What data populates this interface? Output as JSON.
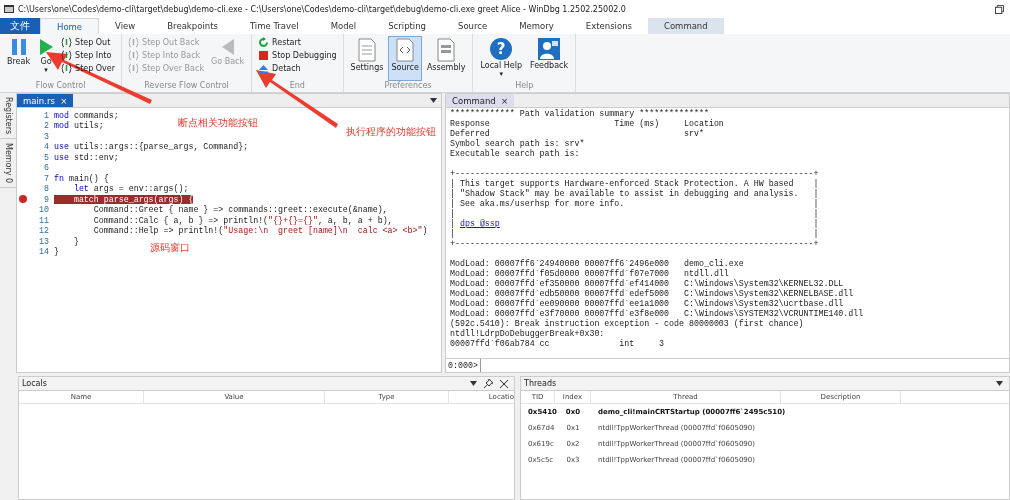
{
  "window": {
    "title": "C:\\Users\\one\\Codes\\demo-cli\\target\\debug\\demo-cli.exe - C:\\Users\\one\\Codes\\demo-cli\\target\\debug\\demo-cli.exe greet Alice - WinDbg 1.2502.25002.0"
  },
  "ribbon_tabs": [
    {
      "label": "文件",
      "kind": "file",
      "selected": false
    },
    {
      "label": "Home",
      "kind": "tab",
      "selected": true
    },
    {
      "label": "View",
      "kind": "tab",
      "selected": false
    },
    {
      "label": "Breakpoints",
      "kind": "tab",
      "selected": false
    },
    {
      "label": "Time Travel",
      "kind": "tab",
      "selected": false
    },
    {
      "label": "Model",
      "kind": "tab",
      "selected": false
    },
    {
      "label": "Scripting",
      "kind": "tab",
      "selected": false
    },
    {
      "label": "Source",
      "kind": "tab",
      "selected": false
    },
    {
      "label": "Memory",
      "kind": "tab",
      "selected": false
    },
    {
      "label": "Extensions",
      "kind": "tab",
      "selected": false
    },
    {
      "label": "Command",
      "kind": "context",
      "selected": false
    }
  ],
  "ribbon_groups": [
    {
      "label": "Flow Control",
      "items": [
        {
          "kind": "large",
          "label": "Break",
          "disabled": false,
          "selected": false
        },
        {
          "kind": "large",
          "label": "Go",
          "caret": "▾",
          "disabled": false,
          "selected": false
        },
        {
          "kind": "stack",
          "items": [
            {
              "label": "Step Out",
              "disabled": false
            },
            {
              "label": "Step Into",
              "disabled": false
            },
            {
              "label": "Step Over",
              "disabled": false
            }
          ]
        }
      ]
    },
    {
      "label": "Reverse Flow Control",
      "items": [
        {
          "kind": "stack",
          "items": [
            {
              "label": "Step Out Back",
              "disabled": true
            },
            {
              "label": "Step Into Back",
              "disabled": true
            },
            {
              "label": "Step Over Back",
              "disabled": true
            }
          ]
        },
        {
          "kind": "large",
          "label": "Go Back",
          "disabled": true,
          "selected": false
        }
      ]
    },
    {
      "label": "End",
      "items": [
        {
          "kind": "stack",
          "items": [
            {
              "label": "Restart",
              "disabled": false
            },
            {
              "label": "Stop Debugging",
              "disabled": false
            },
            {
              "label": "Detach",
              "disabled": false
            }
          ]
        }
      ]
    },
    {
      "label": "Preferences",
      "items": [
        {
          "kind": "large",
          "label": "Settings",
          "disabled": false,
          "selected": false
        },
        {
          "kind": "large",
          "label": "Source",
          "disabled": false,
          "selected": true
        },
        {
          "kind": "large",
          "label": "Assembly",
          "disabled": false,
          "selected": false
        }
      ]
    },
    {
      "label": "Help",
      "items": [
        {
          "kind": "large",
          "glyph": "?",
          "label": "Local Help",
          "caret": "▾",
          "disabled": false,
          "selected": false
        },
        {
          "kind": "large",
          "label": "Feedback",
          "disabled": false,
          "selected": false
        }
      ]
    }
  ],
  "side_tabs": [
    "Registers",
    "Memory 0"
  ],
  "source_tab": {
    "label": "main.rs",
    "close": "×"
  },
  "code_lines": [
    {
      "number": "1",
      "breakpoint": false,
      "segments": [
        {
          "kind": "kw",
          "text": "mod"
        },
        {
          "kind": "plain",
          "text": " commands;"
        }
      ]
    },
    {
      "number": "2",
      "breakpoint": false,
      "segments": [
        {
          "kind": "kw",
          "text": "mod"
        },
        {
          "kind": "plain",
          "text": " utils;"
        }
      ]
    },
    {
      "number": "3",
      "breakpoint": false
    },
    {
      "number": "4",
      "breakpoint": false,
      "segments": [
        {
          "kind": "kw",
          "text": "use"
        },
        {
          "kind": "plain",
          "text": " utils::args::{parse_args, Command};"
        }
      ]
    },
    {
      "number": "5",
      "breakpoint": false,
      "segments": [
        {
          "kind": "kw",
          "text": "use"
        },
        {
          "kind": "plain",
          "text": " std::env;"
        }
      ]
    },
    {
      "number": "6",
      "breakpoint": false
    },
    {
      "number": "7",
      "breakpoint": false,
      "segments": [
        {
          "kind": "kw",
          "text": "fn"
        },
        {
          "kind": "plain",
          "text": " main() {"
        }
      ]
    },
    {
      "number": "8",
      "breakpoint": false,
      "segments": [
        {
          "kind": "kw",
          "text": "    let"
        },
        {
          "kind": "plain",
          "text": " args = env::args();"
        }
      ]
    },
    {
      "number": "9",
      "breakpoint": true,
      "segments": [
        {
          "kind": "kw",
          "text": "    match"
        },
        {
          "kind": "plain",
          "text": " parse_args(args) {"
        }
      ]
    },
    {
      "number": "10",
      "breakpoint": false,
      "segments": [
        {
          "kind": "plain",
          "text": "        Command::Greet { name } => commands::greet::execute(&name),"
        }
      ]
    },
    {
      "number": "11",
      "breakpoint": false,
      "segments": [
        {
          "kind": "plain",
          "text": "        Command::Calc { a, b } => println!("
        },
        {
          "kind": "str",
          "text": "\"{}+{}={}\""
        },
        {
          "kind": "plain",
          "text": ", a, b, a + b),"
        }
      ]
    },
    {
      "number": "12",
      "breakpoint": false,
      "segments": [
        {
          "kind": "plain",
          "text": "        Command::Help => println!("
        },
        {
          "kind": "str",
          "text": "\"Usage:\\n  greet [name]\\n  calc <a> <b>\""
        },
        {
          "kind": "plain",
          "text": ")"
        }
      ]
    },
    {
      "number": "13",
      "breakpoint": false,
      "segments": [
        {
          "kind": "plain",
          "text": "    }"
        }
      ]
    },
    {
      "number": "14",
      "breakpoint": false,
      "segments": [
        {
          "kind": "plain",
          "text": "}"
        }
      ]
    }
  ],
  "annotations": [
    {
      "text": "断点相关功能按钮",
      "kind": "breakpoints"
    },
    {
      "text": "执行程序的功能按钮",
      "kind": "execution"
    },
    {
      "text": "源码窗口",
      "kind": "source"
    }
  ],
  "command_tab": {
    "label": "Command",
    "close": "×"
  },
  "command_output": [
    {
      "kind": "text",
      "text": "************* Path validation summary **************"
    },
    {
      "kind": "text",
      "text": "Response                         Time (ms)     Location"
    },
    {
      "kind": "text",
      "text": "Deferred                                       srv*"
    },
    {
      "kind": "text",
      "text": "Symbol search path is: srv*"
    },
    {
      "kind": "text",
      "text": "Executable search path is:"
    },
    {
      "kind": "blank"
    },
    {
      "kind": "text",
      "text": "+------------------------------------------------------------------------+"
    },
    {
      "kind": "text",
      "text": "| This target supports Hardware-enforced Stack Protection. A HW based    |"
    },
    {
      "kind": "text",
      "text": "| \"Shadow Stack\" may be available to assist in debugging and analysis.   |"
    },
    {
      "kind": "text",
      "text": "| See aka.ms/userhsp for more info.                                      |"
    },
    {
      "kind": "text",
      "text": "|                                                                        |"
    },
    {
      "kind": "link",
      "prefix": "| ",
      "text": "dps @ssp",
      "suffix": "                                                               |"
    },
    {
      "kind": "text",
      "text": "|                                                                        |"
    },
    {
      "kind": "text",
      "text": "+------------------------------------------------------------------------+"
    },
    {
      "kind": "blank"
    },
    {
      "kind": "text",
      "text": "ModLoad: 00007ff6`24940000 00007ff6`2496e000   demo_cli.exe"
    },
    {
      "kind": "text",
      "text": "ModLoad: 00007ffd`f05d0000 00007ffd`f07e7000   ntdll.dll"
    },
    {
      "kind": "text",
      "text": "ModLoad: 00007ffd`ef350000 00007ffd`ef414000   C:\\Windows\\System32\\KERNEL32.DLL"
    },
    {
      "kind": "text",
      "text": "ModLoad: 00007ffd`edb50000 00007ffd`edef5000   C:\\Windows\\System32\\KERNELBASE.dll"
    },
    {
      "kind": "text",
      "text": "ModLoad: 00007ffd`ee090000 00007ffd`ee1a1000   C:\\Windows\\System32\\ucrtbase.dll"
    },
    {
      "kind": "text",
      "text": "ModLoad: 00007ffd`e3f70000 00007ffd`e3f8e000   C:\\Windows\\SYSTEM32\\VCRUNTIME140.dll"
    },
    {
      "kind": "text",
      "text": "(592c.5410): Break instruction exception - code 80000003 (first chance)"
    },
    {
      "kind": "text",
      "text": "ntdll!LdrpDoDebuggerBreak+0x30:"
    },
    {
      "kind": "text",
      "text": "00007ffd`f06ab784 cc              int     3"
    }
  ],
  "command_prompt": "0:000>",
  "locals": {
    "title": "Locals",
    "columns": [
      "Name",
      "Value",
      "Type",
      "Locatio"
    ]
  },
  "threads": {
    "title": "Threads",
    "columns": [
      "TID",
      "Index",
      "Thread",
      "Description"
    ],
    "rows": [
      {
        "tid": "0x5410",
        "index": "0x0",
        "thread": "demo_cli!mainCRTStartup (00007ff6`2495c510)",
        "current": true
      },
      {
        "tid": "0x67d4",
        "index": "0x1",
        "thread": "ntdll!TppWorkerThread (00007ffd`f0605090)",
        "current": false
      },
      {
        "tid": "0x619c",
        "index": "0x2",
        "thread": "ntdll!TppWorkerThread (00007ffd`f0605090)",
        "current": false
      },
      {
        "tid": "0x5c5c",
        "index": "0x3",
        "thread": "ntdll!TppWorkerThread (00007ffd`f0605090)",
        "current": false
      }
    ]
  }
}
